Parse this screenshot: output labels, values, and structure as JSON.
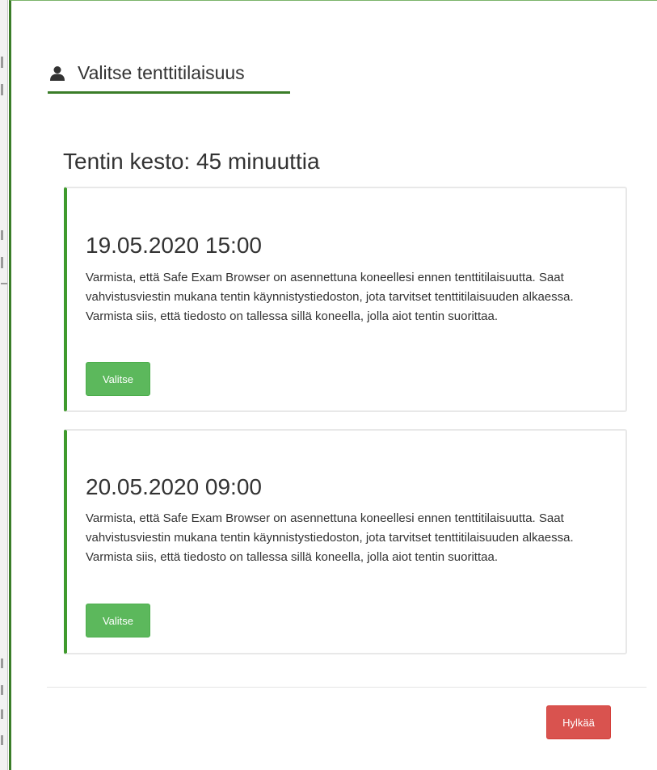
{
  "modal": {
    "title": "Valitse tenttitilaisuus",
    "title_icon": "user-icon",
    "duration_text": "Tentin kesto: 45 minuuttia"
  },
  "slots": [
    {
      "date": "19.05.2020 15:00",
      "description": "Varmista, että Safe Exam Browser on asennettuna koneellesi ennen tenttitilaisuutta. Saat vahvistusviestin mukana tentin käynnistystiedoston, jota tarvitset tenttitilaisuuden alkaessa. Varmista siis, että tiedosto on tallessa sillä koneella, jolla aiot tentin suorittaa.",
      "button_label": "Valitse"
    },
    {
      "date": "20.05.2020 09:00",
      "description": "Varmista, että Safe Exam Browser on asennettuna koneellesi ennen tenttitilaisuutta. Saat vahvistusviestin mukana tentin käynnistystiedoston, jota tarvitset tenttitilaisuuden alkaessa. Varmista siis, että tiedosto on tallessa sillä koneella, jolla aiot tentin suorittaa.",
      "button_label": "Valitse"
    }
  ],
  "footer": {
    "cancel_label": "Hylkää"
  },
  "colors": {
    "accent_green": "#3a7d28",
    "button_green": "#5cb85c",
    "button_red": "#d9534f"
  }
}
